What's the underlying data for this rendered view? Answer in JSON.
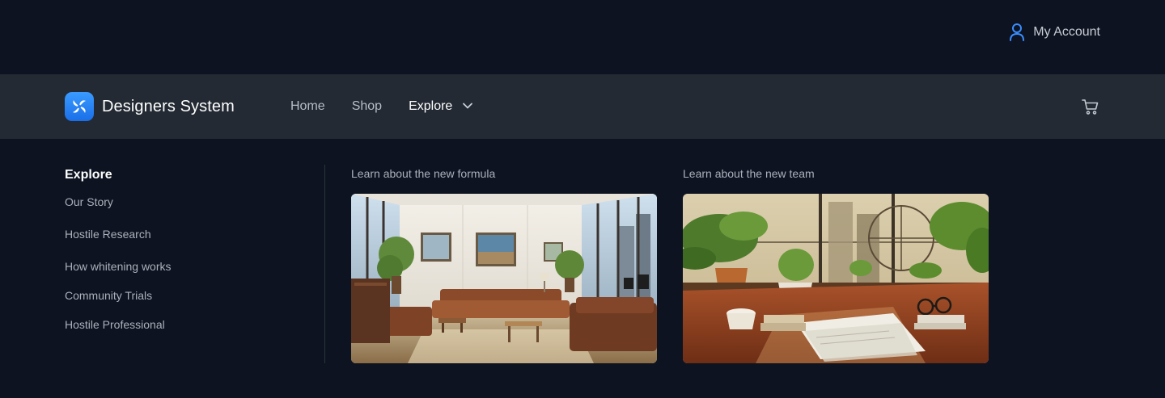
{
  "topbar": {
    "account_label": "My Account",
    "account_icon": "user-icon"
  },
  "brand": {
    "name": "Designers System",
    "logo_icon": "swirl-logo-icon"
  },
  "nav": {
    "links": [
      {
        "label": "Home"
      },
      {
        "label": "Shop"
      },
      {
        "label": "Explore"
      }
    ],
    "cart_icon": "cart-icon"
  },
  "mega_menu": {
    "heading": "Explore",
    "items": [
      "Our Story",
      "Hostile Research",
      "How whitening works",
      "Community Trials",
      "Hostile Professional"
    ],
    "cards": [
      {
        "label": "Learn about the new formula",
        "image": "living-room-image"
      },
      {
        "label": "Learn about the new team",
        "image": "desk-plants-image"
      }
    ]
  },
  "colors": {
    "background": "#0d1320",
    "navbar": "#232a33",
    "accent": "#3a8dff"
  }
}
